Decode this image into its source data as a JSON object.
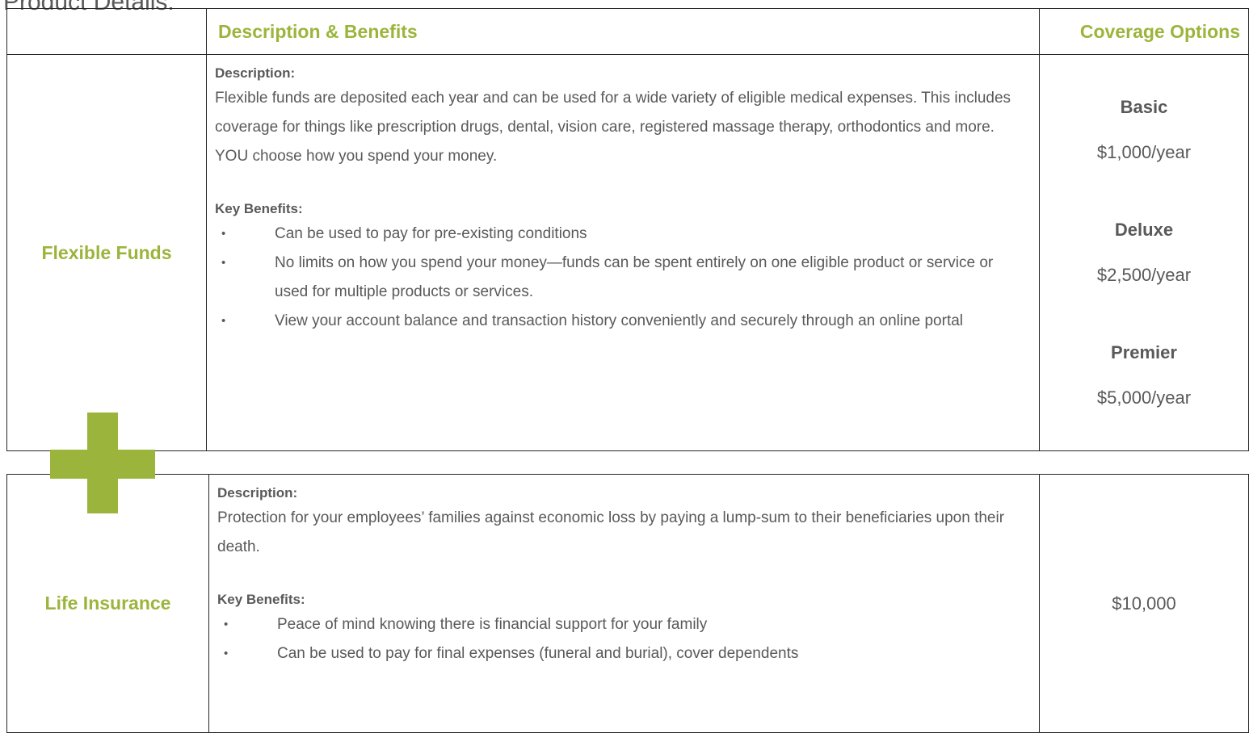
{
  "page": {
    "title": "Product Details:"
  },
  "header": {
    "col1": "",
    "col2": "Description & Benefits",
    "col3": "Coverage Options"
  },
  "products": [
    {
      "name": "Flexible Funds",
      "description_label": "Description:",
      "description": "Flexible funds are deposited each year and can be used for a wide variety of eligible medical expenses. This includes coverage for things like  prescription drugs, dental, vision care, registered massage therapy,  orthodontics and more.  YOU choose how you spend your money.",
      "benefits_label": "Key Benefits:",
      "benefits": [
        "Can be used to pay for pre-existing conditions",
        "No limits on how you spend your money—funds can be spent entirely on one eligible product or service or used for multiple products or services.",
        "View your account balance and transaction history conveniently and securely through an online portal"
      ],
      "coverage": [
        {
          "tier": "Basic",
          "price": "$1,000/year"
        },
        {
          "tier": "Deluxe",
          "price": "$2,500/year"
        },
        {
          "tier": "Premier",
          "price": "$5,000/year"
        }
      ]
    },
    {
      "name": "Life Insurance",
      "description_label": "Description:",
      "description": "Protection  for your employees’ families against economic loss by paying a lump-sum to their beneficiaries upon their death.",
      "benefits_label": "Key Benefits:",
      "benefits": [
        "Peace of mind knowing there is financial support for your family",
        "Can be used to pay  for final expenses (funeral and burial), cover dependents"
      ],
      "coverage_amount": "$10,000"
    }
  ],
  "bullet_glyph": "•",
  "icons": {
    "plus": "plus-icon"
  },
  "colors": {
    "accent": "#9bb53c",
    "text": "#595959",
    "border": "#262626"
  }
}
